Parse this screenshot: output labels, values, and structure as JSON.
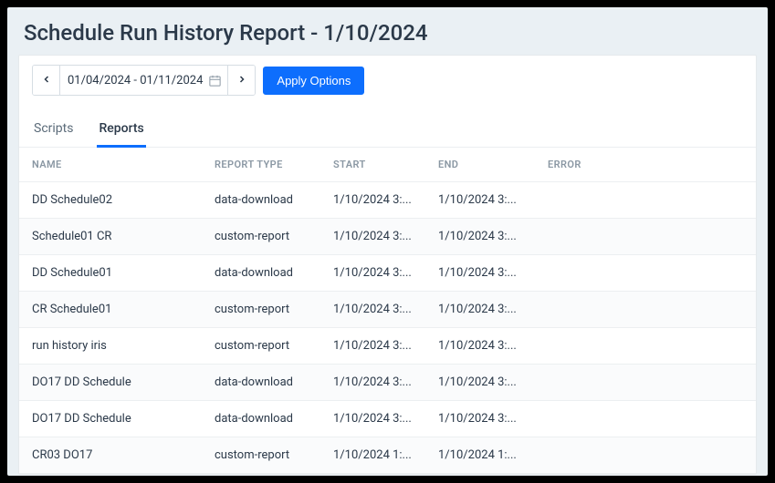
{
  "page": {
    "title": "Schedule Run History Report - 1/10/2024"
  },
  "options": {
    "date_range": "01/04/2024 - 01/11/2024",
    "apply_label": "Apply Options"
  },
  "tabs": [
    {
      "label": "Scripts",
      "active": false
    },
    {
      "label": "Reports",
      "active": true
    }
  ],
  "columns": {
    "name": "NAME",
    "type": "REPORT TYPE",
    "start": "START",
    "end": "END",
    "error": "ERROR"
  },
  "rows": [
    {
      "name": "DD Schedule02",
      "type": "data-download",
      "start": "1/10/2024 3:...",
      "end": "1/10/2024 3:...",
      "error": ""
    },
    {
      "name": "Schedule01 CR",
      "type": "custom-report",
      "start": "1/10/2024 3:...",
      "end": "1/10/2024 3:...",
      "error": ""
    },
    {
      "name": "DD Schedule01",
      "type": "data-download",
      "start": "1/10/2024 3:...",
      "end": "1/10/2024 3:...",
      "error": ""
    },
    {
      "name": "CR Schedule01",
      "type": "custom-report",
      "start": "1/10/2024 3:...",
      "end": "1/10/2024 3:...",
      "error": ""
    },
    {
      "name": "run history iris",
      "type": "custom-report",
      "start": "1/10/2024 3:...",
      "end": "1/10/2024 3:...",
      "error": ""
    },
    {
      "name": "DO17 DD Schedule",
      "type": "data-download",
      "start": "1/10/2024 3:...",
      "end": "1/10/2024 3:...",
      "error": ""
    },
    {
      "name": "DO17 DD Schedule",
      "type": "data-download",
      "start": "1/10/2024 3:...",
      "end": "1/10/2024 3:...",
      "error": ""
    },
    {
      "name": "CR03 DO17",
      "type": "custom-report",
      "start": "1/10/2024 1:...",
      "end": "1/10/2024 1:...",
      "error": ""
    }
  ]
}
